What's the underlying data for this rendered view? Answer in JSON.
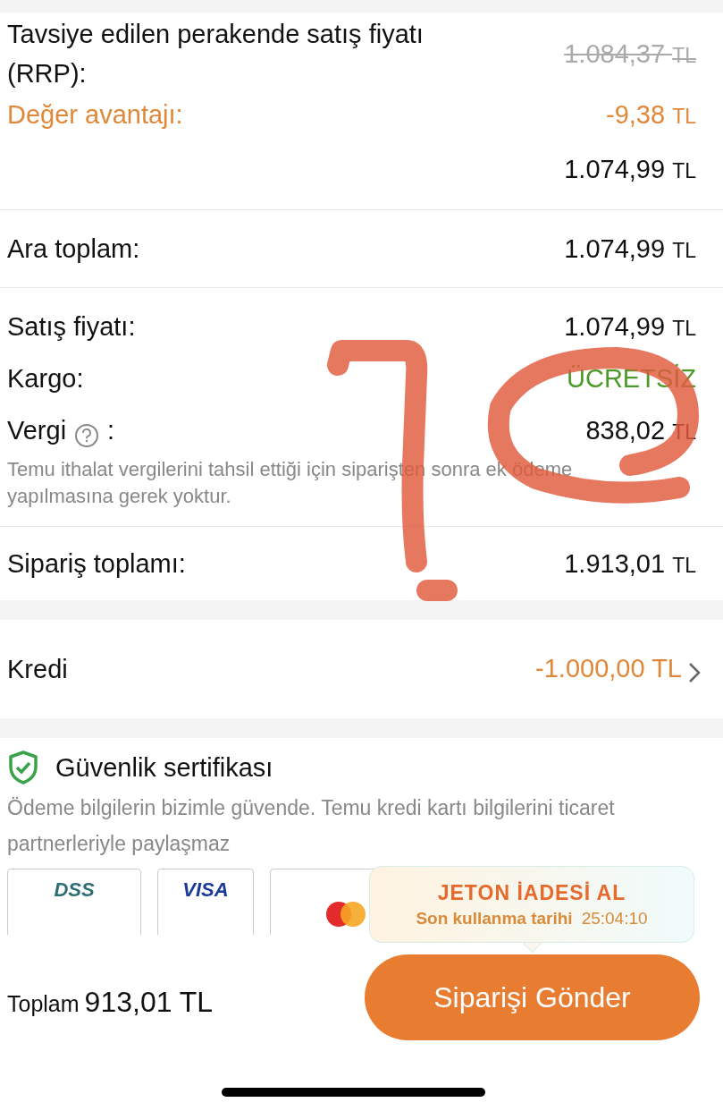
{
  "price_breakdown": [
    {
      "kind": "struck",
      "label": "Tavsiye edilen perakende satış fiyatı (RRP):",
      "amount": "1.084,37",
      "currency": "TL"
    },
    {
      "kind": "discount",
      "label": "Değer avantajı:",
      "amount": "-9,38",
      "currency": "TL"
    },
    {
      "kind": "plain",
      "amount": "1.074,99",
      "currency": "TL"
    }
  ],
  "subtotal": {
    "label": "Ara toplam:",
    "amount": "1.074,99",
    "currency": "TL"
  },
  "charges": [
    {
      "kind": "plain",
      "label": "Satış fiyatı:",
      "amount": "1.074,99",
      "currency": "TL"
    },
    {
      "kind": "free",
      "label": "Kargo:",
      "amount": "ÜCRETSİZ"
    },
    {
      "kind": "tax",
      "label": "Vergi",
      "suffix": ":",
      "amount": "838,02",
      "currency": "TL",
      "note": "Temu ithalat vergilerini tahsil ettiği için siparişten sonra ek ödeme yapılmasına gerek yoktur."
    }
  ],
  "order_total": {
    "label": "Sipariş toplamı:",
    "amount": "1.913,01",
    "currency": "TL"
  },
  "credit": {
    "label": "Kredi",
    "amount": "-1.000,00 TL"
  },
  "security": {
    "title": "Güvenlik sertifikası",
    "text": "Ödeme bilgilerin bizimle güvende. Temu kredi kartı bilgilerini ticaret partnerleriyle paylaşmaz",
    "logos": [
      {
        "kind": "pci",
        "text": "DSS"
      },
      {
        "kind": "visa",
        "text": "VISA"
      },
      {
        "kind": "mastercard"
      }
    ]
  },
  "tooltip": {
    "title": "JETON İADESİ AL",
    "label": "Son kullanma tarihi",
    "countdown": "25:04:10"
  },
  "footer": {
    "label": "Toplam",
    "amount": "913,01 TL",
    "button": "Siparişi Gönder"
  }
}
